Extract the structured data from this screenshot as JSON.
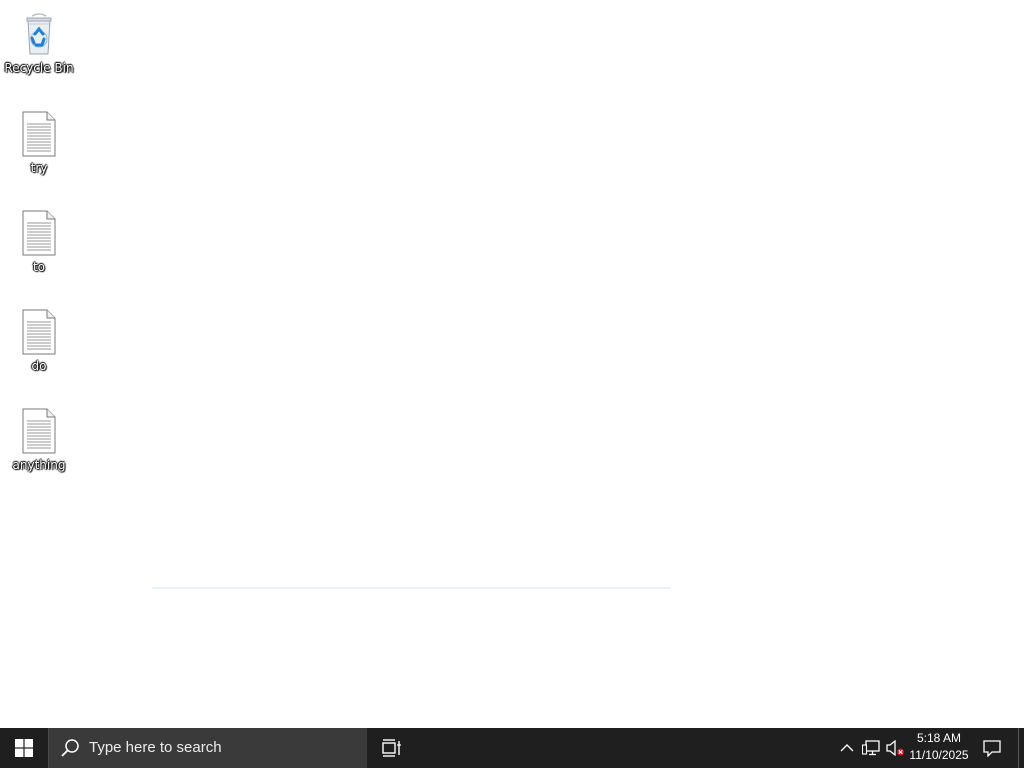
{
  "desktop": {
    "icons": [
      {
        "label": "Recycle Bin",
        "icon": "recycle-bin-icon"
      },
      {
        "label": "try",
        "icon": "text-document-icon"
      },
      {
        "label": "to",
        "icon": "text-document-icon"
      },
      {
        "label": "do",
        "icon": "text-document-icon"
      },
      {
        "label": "anything",
        "icon": "text-document-icon"
      }
    ]
  },
  "taskbar": {
    "start_icon": "windows-logo-icon",
    "search": {
      "placeholder": "Type here to search",
      "icon": "search-icon"
    },
    "task_view_icon": "task-view-icon",
    "tray": {
      "chevron_icon": "chevron-up-icon",
      "network_icon": "network-icon",
      "volume_icon": "volume-muted-icon",
      "time": "5:18 AM",
      "date": "11/10/2025",
      "notification_icon": "action-center-icon"
    }
  },
  "colors": {
    "taskbar_bg": "#1f1f1f",
    "search_bg": "#3a3a3a",
    "desktop_bg": "#ffffff",
    "windows_blue": "#ffffff",
    "mute_red": "#e81123"
  }
}
